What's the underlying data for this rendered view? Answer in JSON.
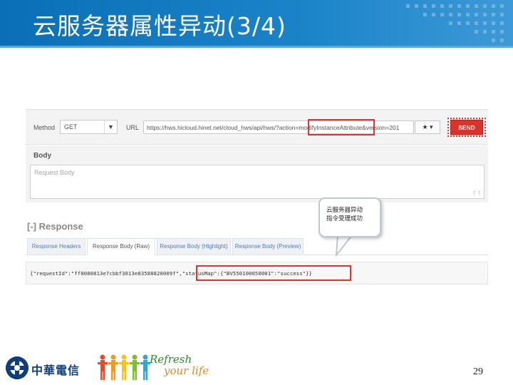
{
  "slide": {
    "title": "云服务器属性异动(3/4)",
    "page_number": "29"
  },
  "request": {
    "method_label": "Method",
    "method_value": "GET",
    "url_label": "URL",
    "url_value": "https://hws.hicloud.hinet.net/cloud_hws/api/hws/?action=modifyInstanceAttribute&version=201",
    "star_icon": "star-icon",
    "send_label": "SEND"
  },
  "body": {
    "title": "Body",
    "placeholder": "Request Body"
  },
  "response": {
    "title": "[-] Response",
    "tabs": [
      {
        "label": "Response Headers",
        "active": false
      },
      {
        "label": "Response Body (Raw)",
        "active": true
      },
      {
        "label": "Response Body (Highlight)",
        "active": false
      },
      {
        "label": "Response Body (Preview)",
        "active": false
      }
    ],
    "raw": "{\"requestId\":\"ff8080813e7cbbf3013e83588820009f\",\"statusMap\":{\"BV550100050001\":\"success\"}}"
  },
  "callout": {
    "line1": "云服务器异动",
    "line2": "指令受理成功"
  },
  "footer": {
    "company": "中華電信",
    "slogan_line1": "Refresh",
    "slogan_line2": "your life"
  },
  "colors": {
    "title_bar": "#0a6fb6",
    "send_button": "#d9332c",
    "highlight_box": "#e0352e",
    "tab_link": "#4a7fc1"
  }
}
